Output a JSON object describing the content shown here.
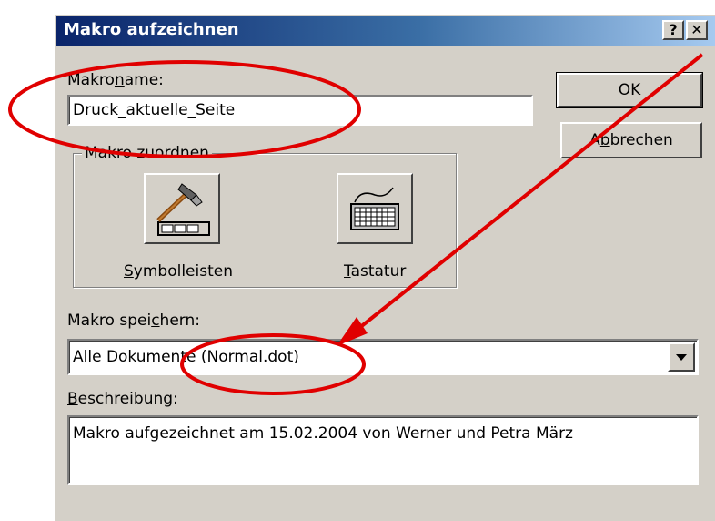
{
  "dialog": {
    "title": "Makro aufzeichnen",
    "help_button": "?",
    "close_button": "✕"
  },
  "macro_name": {
    "label_pre": "Makro",
    "label_underlined": "n",
    "label_post": "ame:",
    "value": "Druck_aktuelle_Seite"
  },
  "buttons": {
    "ok": "OK",
    "cancel_pre": "A",
    "cancel_underlined": "b",
    "cancel_post": "brechen"
  },
  "assign_group": {
    "title": "Makro zuordnen",
    "toolbars_underlined": "S",
    "toolbars_rest": "ymbolleisten",
    "keyboard_underlined": "T",
    "keyboard_rest": "astatur"
  },
  "store_in": {
    "label_pre": "Makro spei",
    "label_underlined": "c",
    "label_post": "hern:",
    "value": "Alle Dokumente (Normal.dot)"
  },
  "description": {
    "label_underlined": "B",
    "label_rest": "eschreibung:",
    "value": "Makro aufgezeichnet am 15.02.2004 von Werner und Petra März"
  },
  "colors": {
    "annotation": "#e00000",
    "face": "#d4d0c8",
    "title_start": "#0a246a",
    "title_end": "#a6caf0"
  }
}
